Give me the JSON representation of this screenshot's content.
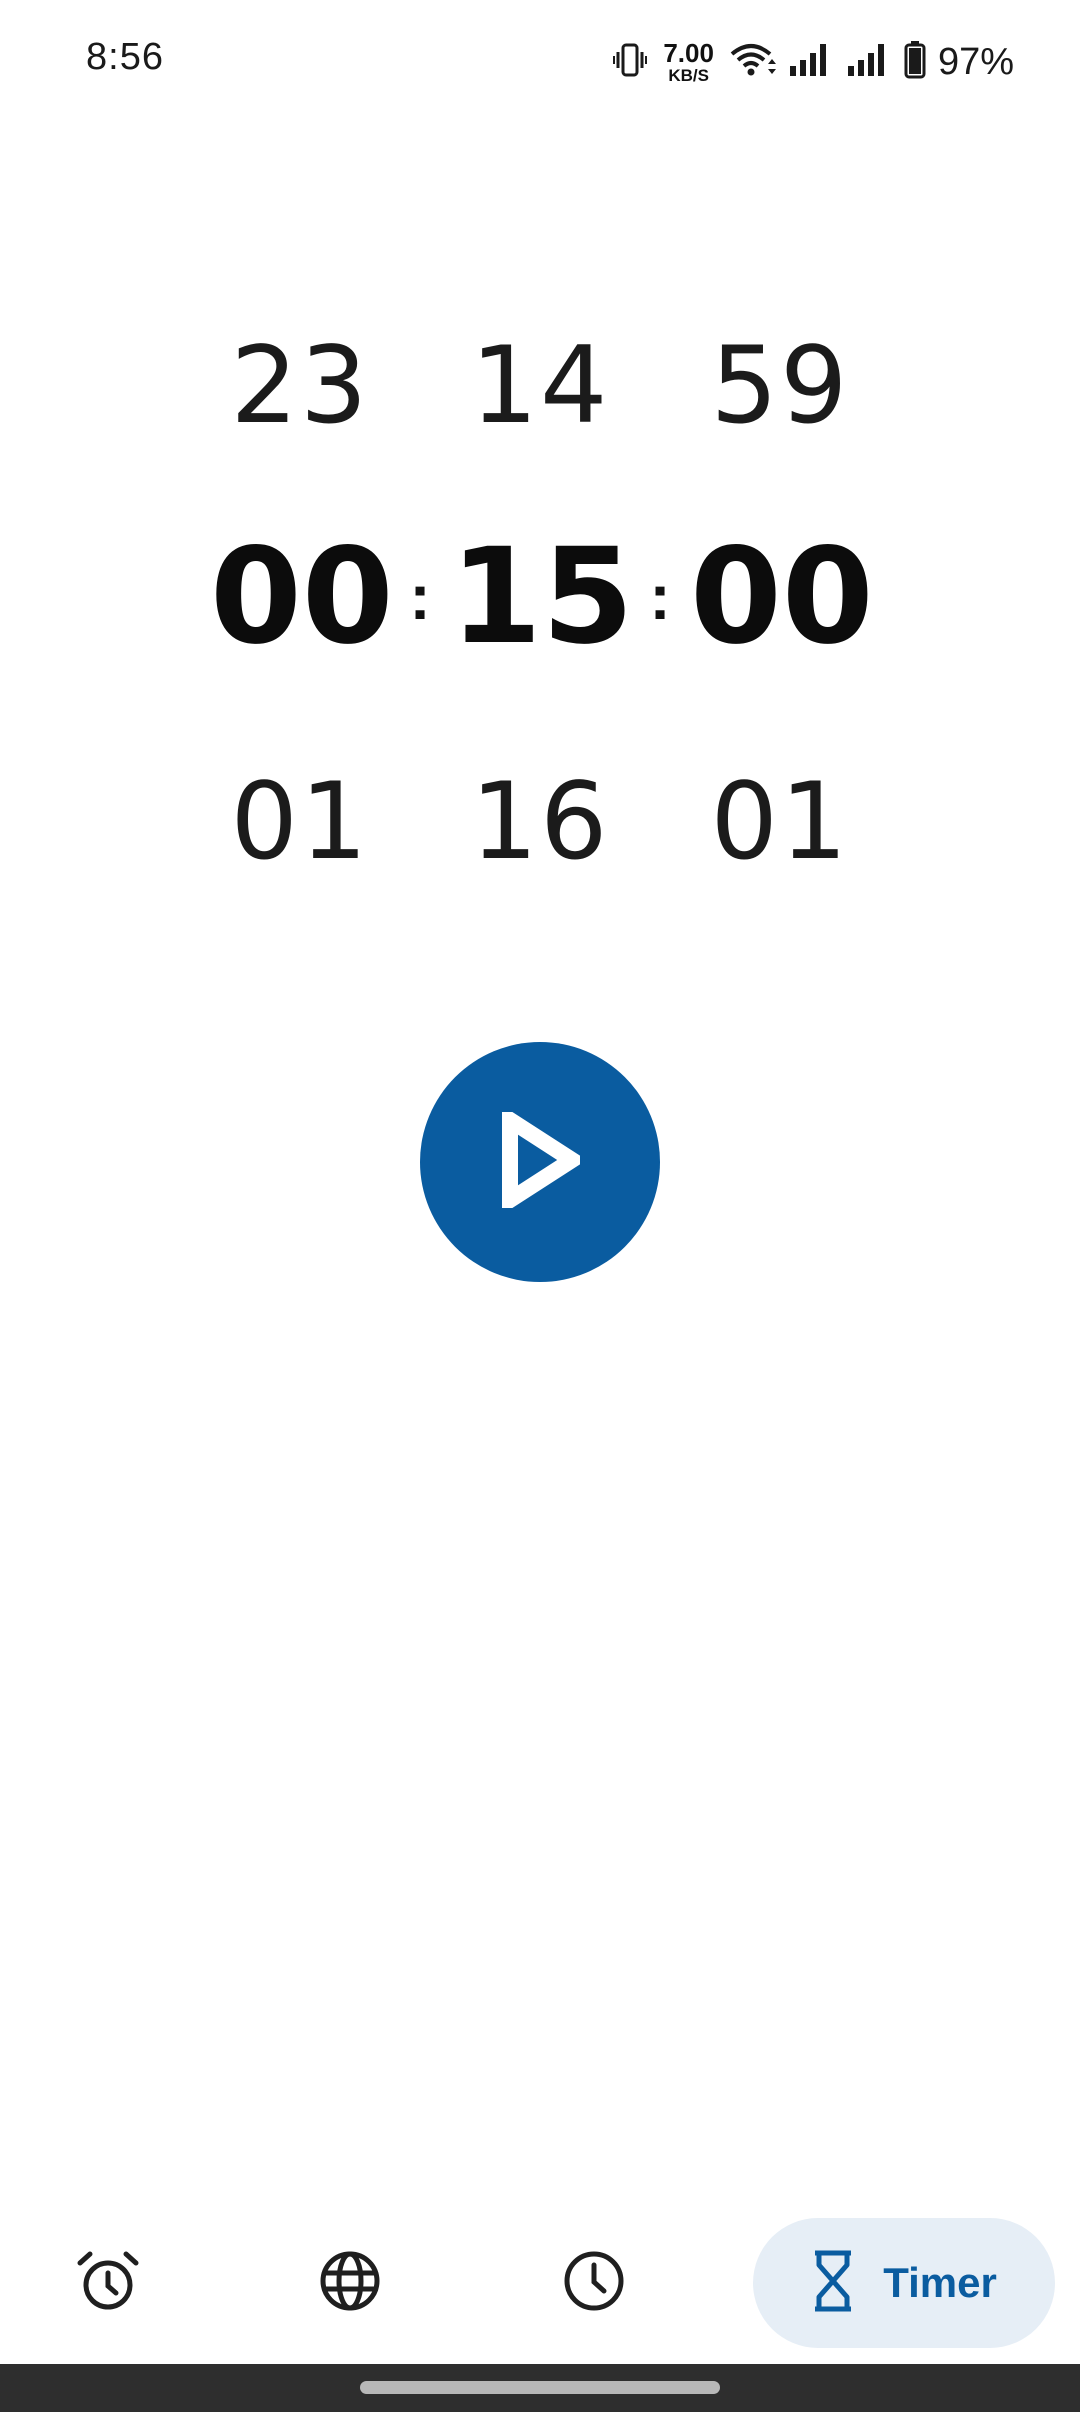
{
  "status_bar": {
    "time": "8:56",
    "net_speed_value": "7.00",
    "net_speed_unit": "KB/S",
    "battery_percent": "97%",
    "icons": [
      "vibrate-icon",
      "wifi-icon",
      "signal-icon",
      "signal-icon",
      "battery-icon"
    ]
  },
  "picker": {
    "prev": {
      "hours": "23",
      "minutes": "14",
      "seconds": "59"
    },
    "current": {
      "hours": "00",
      "minutes": "15",
      "seconds": "00"
    },
    "next": {
      "hours": "01",
      "minutes": "16",
      "seconds": "01"
    },
    "separator": ":"
  },
  "start_button": {
    "icon": "play-icon"
  },
  "bottom_nav": {
    "items": [
      {
        "icon": "alarm-icon",
        "label": ""
      },
      {
        "icon": "globe-icon",
        "label": ""
      },
      {
        "icon": "clock-icon",
        "label": ""
      },
      {
        "icon": "hourglass-icon",
        "label": "Timer",
        "active": true
      }
    ]
  },
  "colors": {
    "accent": "#0a5ca0",
    "active_pill": "#e6eef6",
    "gesture_bar": "#2e2e2e"
  }
}
